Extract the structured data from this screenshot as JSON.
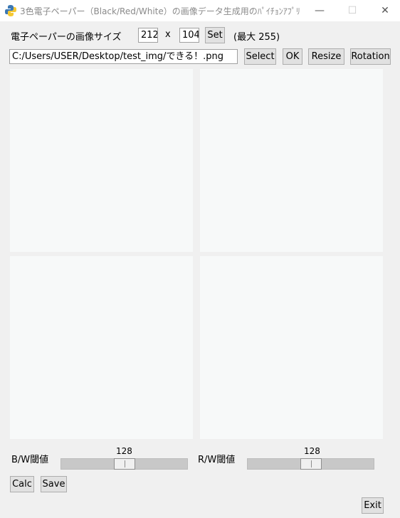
{
  "window": {
    "title": "3色電子ペーパー（Black/Red/White）の画像データ生成用のﾊﾟｲﾁｮﾝｱﾌﾟﾘ",
    "minimize": "—",
    "maximize": "☐",
    "close": "✕"
  },
  "size_row": {
    "label": "電子ペーパーの画像サイズ",
    "width_value": "212",
    "x_label": "x",
    "height_value": "104",
    "set_label": "Set",
    "max_note": "(最大 255)"
  },
  "file_row": {
    "path": "C:/Users/USER/Desktop/test_img/できる！.png",
    "select_label": "Select",
    "ok_label": "OK",
    "resize_label": "Resize",
    "rotation_label": "Rotation"
  },
  "thresholds": {
    "bw_label": "B/W閾値",
    "bw_value": "128",
    "bw_fraction": 0.5,
    "rw_label": "R/W閾値",
    "rw_value": "128",
    "rw_fraction": 0.5
  },
  "actions": {
    "calc_label": "Calc",
    "save_label": "Save",
    "exit_label": "Exit"
  }
}
